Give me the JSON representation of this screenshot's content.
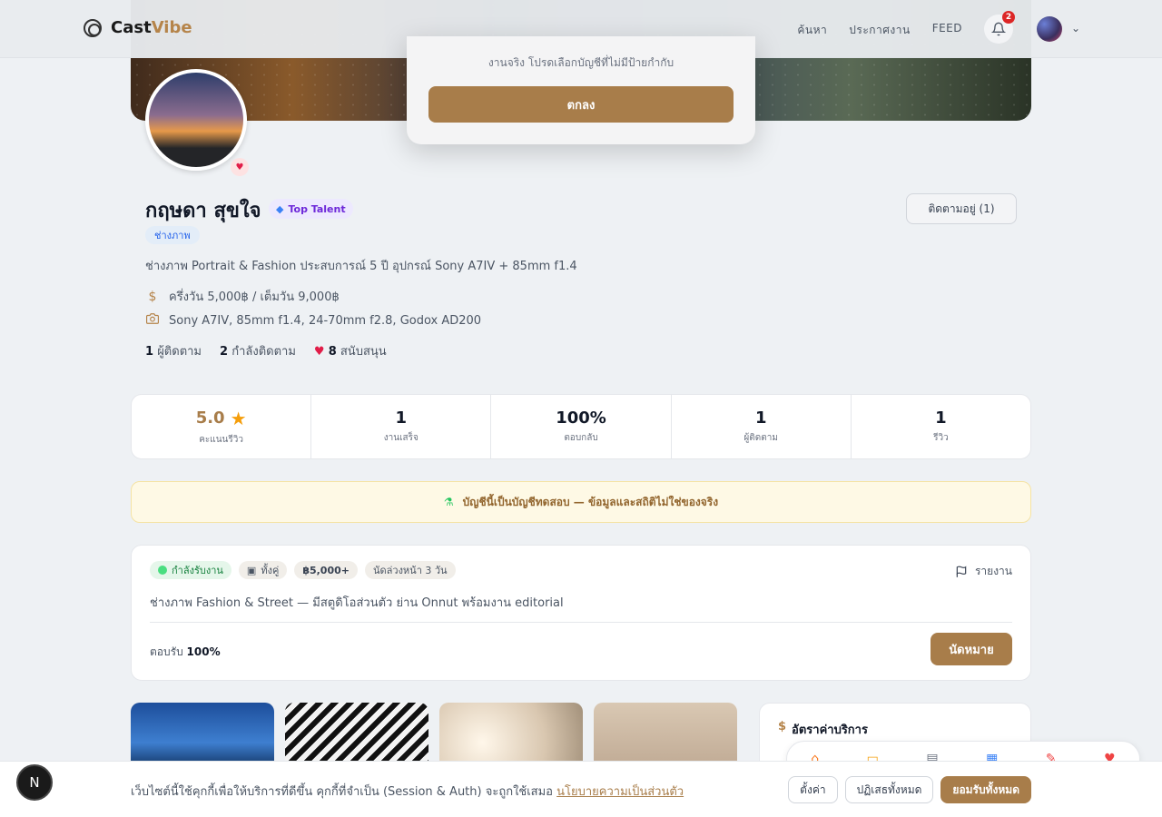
{
  "header": {
    "brand_main": "Cast",
    "brand_accent": "Vibe",
    "nav": [
      "ค้นหา",
      "ประกาศงาน",
      "FEED"
    ],
    "notification_count": "2"
  },
  "modal": {
    "text": "งานจริง โปรดเลือกบัญชีที่ไม่มีป้ายกำกับ",
    "ok_label": "ตกลง"
  },
  "profile": {
    "name": "กฤษดา สุขใจ",
    "badge": "Top Talent",
    "follow_label": "ติดตามอยู่ (1)",
    "role": "ช่างภาพ",
    "bio": "ช่างภาพ Portrait & Fashion ประสบการณ์ 5 ปี อุปกรณ์ Sony A7IV + 85mm f1.4",
    "rate": "ครึ่งวัน 5,000฿ / เต็มวัน 9,000฿",
    "gear": "Sony A7IV, 85mm f1.4, 24-70mm f2.8, Godox AD200",
    "followers_count": "1",
    "followers_label": "ผู้ติดตาม",
    "following_count": "2",
    "following_label": "กำลังติดตาม",
    "supporters_count": "8",
    "supporters_label": "สนับสนุน"
  },
  "stats": [
    {
      "value": "5.0",
      "label": "คะแนนรีวิว"
    },
    {
      "value": "1",
      "label": "งานเสร็จ"
    },
    {
      "value": "100%",
      "label": "ตอบกลับ"
    },
    {
      "value": "1",
      "label": "ผู้ติดตาม"
    },
    {
      "value": "1",
      "label": "รีวิว"
    }
  ],
  "test_banner": "บัญชีนี้เป็นบัญชีทดสอบ — ข้อมูลและสถิติไม่ใช่ของจริง",
  "listing": {
    "status": "กำลังรับงาน",
    "type": "ทั้งคู่",
    "price": "฿5,000+",
    "notice": "นัดล่วงหน้า 3 วัน",
    "report_label": "รายงาน",
    "description": "ช่างภาพ Fashion & Street — มีสตูดิโอส่วนตัว ย่าน Onnut พร้อมงาน editorial",
    "reply_label": "ตอบรับ",
    "reply_value": "100%",
    "book_label": "นัดหมาย"
  },
  "rates": {
    "title": "อัตราค่าบริการ"
  },
  "cookie": {
    "text": "เว็บไซต์นี้ใช้คุกกี้เพื่อให้บริการที่ดีขึ้น คุกกี้ที่จำเป็น (Session & Auth) จะถูกใช้เสมอ",
    "link": "นโยบายความเป็นส่วนตัว",
    "settings": "ตั้งค่า",
    "reject": "ปฏิเสธทั้งหมด",
    "accept": "ยอมรับทั้งหมด"
  },
  "dev_badge": "N"
}
